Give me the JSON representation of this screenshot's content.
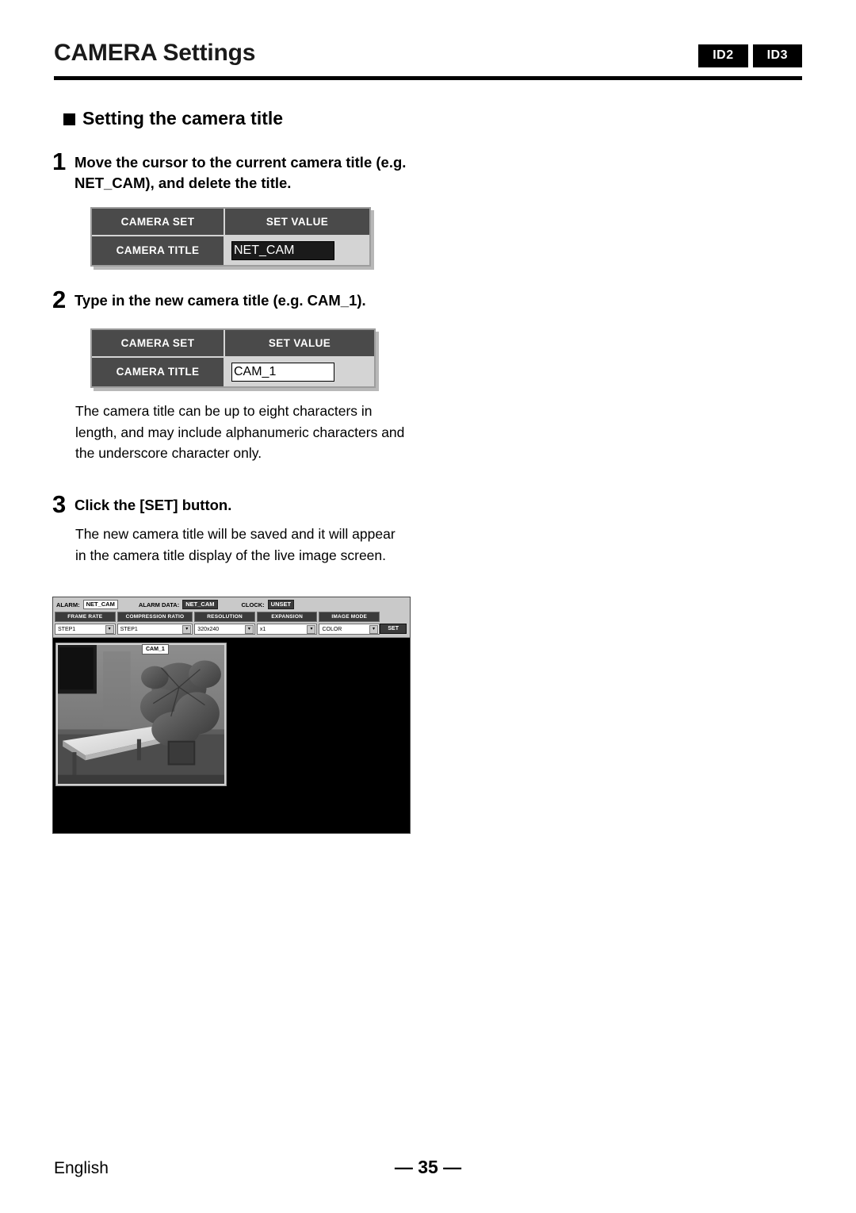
{
  "header": {
    "title": "CAMERA Settings",
    "badges": [
      "ID2",
      "ID3"
    ]
  },
  "section": {
    "heading": "Setting the camera title"
  },
  "steps": [
    {
      "number": "1",
      "text": "Move the cursor to the current camera title (e.g. NET_CAM), and delete the title."
    },
    {
      "number": "2",
      "text": "Type in the new camera title (e.g. CAM_1)."
    },
    {
      "number": "3",
      "text": "Click the [SET] button."
    }
  ],
  "paragraphs": {
    "p1": "The camera title can be up to eight characters in length, and may include alphanumeric characters and the underscore character only.",
    "p2": "The new camera title will be saved and it will appear in the camera title display of the live image screen."
  },
  "tables": [
    {
      "headers": [
        "CAMERA SET",
        "SET VALUE"
      ],
      "row_label": "CAMERA TITLE",
      "input_value": "NET_CAM",
      "input_selected": true
    },
    {
      "headers": [
        "CAMERA SET",
        "SET VALUE"
      ],
      "row_label": "CAMERA TITLE",
      "input_value": "CAM_1",
      "input_selected": false
    }
  ],
  "live_screen": {
    "status": {
      "alarm_label": "ALARM:",
      "alarm_value": "NET_CAM",
      "alarm_data_label": "ALARM DATA:",
      "alarm_data_value": "NET_CAM",
      "clock_label": "CLOCK:",
      "clock_value": "UNSET"
    },
    "controls": [
      {
        "header": "FRAME RATE",
        "value": "STEP1"
      },
      {
        "header": "COMPRESSION RATIO",
        "value": "STEP1"
      },
      {
        "header": "RESOLUTION",
        "value": "320x240"
      },
      {
        "header": "EXPANSION",
        "value": "x1"
      },
      {
        "header": "IMAGE MODE",
        "value": "COLOR"
      }
    ],
    "set_button": "SET",
    "camera_title_overlay": "CAM_1"
  },
  "footer": {
    "language": "English",
    "page": "— 35 —"
  }
}
